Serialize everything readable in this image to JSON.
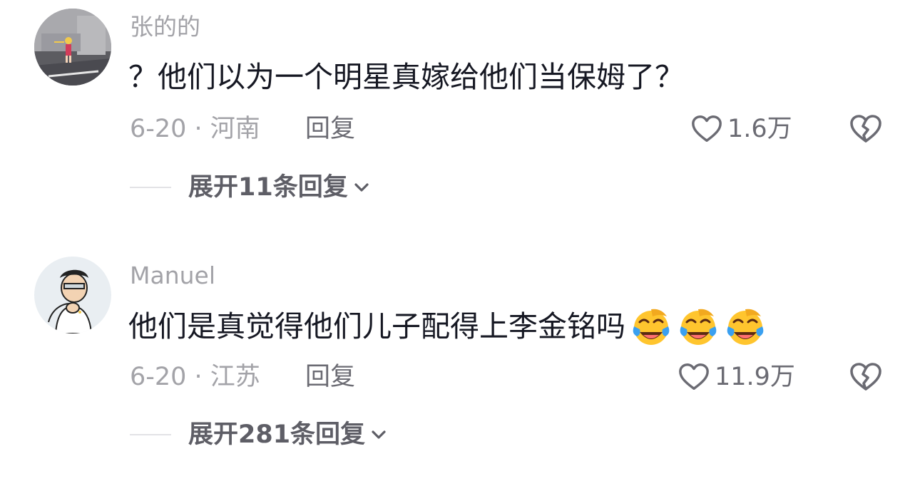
{
  "comments": [
    {
      "username": "张的的",
      "text": "？他们以为一个明星真嫁给他们当保姆了？",
      "emojis": [],
      "date_location": "6-20 · 河南",
      "reply_label": "回复",
      "likes": "1.6万",
      "expand_label": "展开11条回复"
    },
    {
      "username": "Manuel",
      "text": "他们是真觉得他们儿子配得上李金铭吗",
      "emojis": [
        "laughing-crying-emoji",
        "laughing-crying-emoji",
        "laughing-crying-emoji"
      ],
      "date_location": "6-20 · 江苏",
      "reply_label": "回复",
      "likes": "11.9万",
      "expand_label": "展开281条回复"
    }
  ],
  "icons": {
    "like": "heart-outline-icon",
    "dislike": "broken-heart-icon",
    "expand": "chevron-down-icon"
  },
  "colors": {
    "text_primary": "#161823",
    "text_secondary": "#a3a3a8",
    "text_action": "#6b6b73",
    "emoji_yellow": "#ffc52e",
    "emoji_tear": "#3aa0f0"
  }
}
